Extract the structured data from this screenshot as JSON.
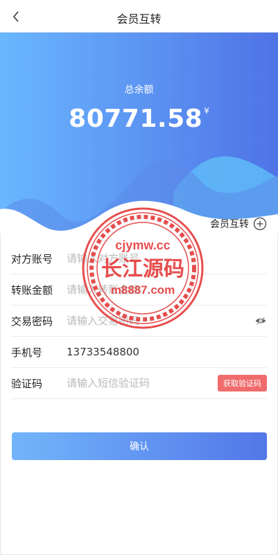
{
  "header": {
    "title": "会员互转"
  },
  "hero": {
    "balance_label": "总余额",
    "balance_amount": "80771.58",
    "currency_symbol": "¥",
    "gradient_start": "#6ab7ff",
    "gradient_end": "#4f73e6"
  },
  "transfer_link": {
    "label": "会员互转",
    "icon": "plus-circle-icon"
  },
  "form": {
    "rows": [
      {
        "label": "对方账号",
        "placeholder": "请输入对方账号",
        "value": ""
      },
      {
        "label": "转账金额",
        "placeholder": "请输入转账金额",
        "value": ""
      },
      {
        "label": "交易密码",
        "placeholder": "请输入交易密码",
        "value": ""
      },
      {
        "label": "手机号",
        "placeholder": "",
        "value": "13733548800"
      },
      {
        "label": "验证码",
        "placeholder": "请输入短信验证码",
        "value": ""
      }
    ],
    "get_code_label": "获取验证码"
  },
  "confirm_label": "确认",
  "watermark": {
    "line1": "cjymw.cc",
    "line2": "长江源码",
    "line3": "m8887.com"
  }
}
